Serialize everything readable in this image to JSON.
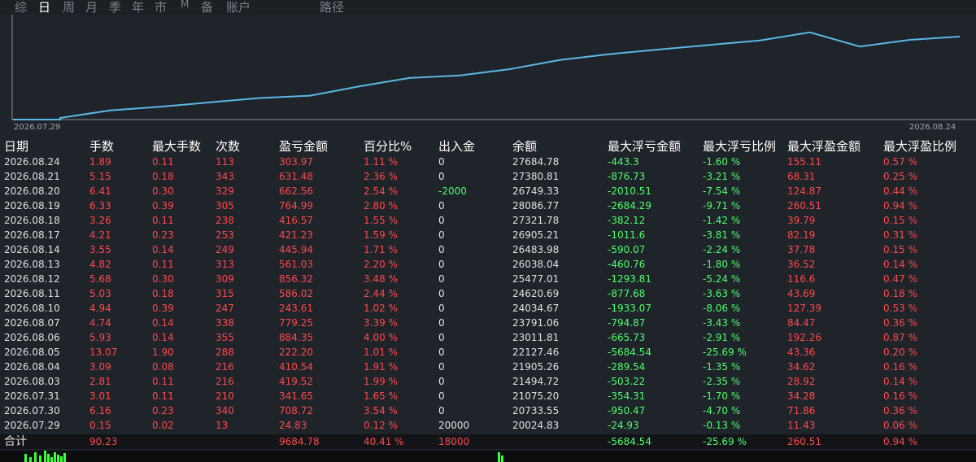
{
  "tabs": [
    "综",
    "日",
    "周",
    "月",
    "季",
    "年",
    "市",
    "M",
    "备",
    "账户",
    "路径"
  ],
  "active_tab": "日",
  "chart": {
    "start_date": "2026.07.29",
    "end_date": "2026.08.24",
    "line_color": "#5ab8e6",
    "balances": [
      20024.83,
      20733.55,
      21075.2,
      21494.72,
      21905.26,
      22127.46,
      23011.81,
      23791.06,
      24034.67,
      24620.69,
      25477.01,
      26038.04,
      26483.98,
      26905.21,
      27321.78,
      28086.77,
      26749.33,
      27380.81,
      27684.78
    ]
  },
  "table": {
    "headers": [
      "日期",
      "手数",
      "最大手数",
      "次数",
      "盈亏金额",
      "百分比%",
      "出入金",
      "余额",
      "最大浮亏金额",
      "最大浮亏比例",
      "最大浮盈金额",
      "最大浮盈比例"
    ],
    "rows": [
      [
        "2026.08.24",
        "1.89",
        "0.11",
        "113",
        "303.97",
        "1.11 %",
        "0",
        "27684.78",
        "-443.3",
        "-1.60 %",
        "155.11",
        "0.57 %"
      ],
      [
        "2026.08.21",
        "5.15",
        "0.18",
        "343",
        "631.48",
        "2.36 %",
        "0",
        "27380.81",
        "-876.73",
        "-3.21 %",
        "68.31",
        "0.25 %"
      ],
      [
        "2026.08.20",
        "6.41",
        "0.30",
        "329",
        "662.56",
        "2.54 %",
        "-2000",
        "26749.33",
        "-2010.51",
        "-7.54 %",
        "124.87",
        "0.44 %"
      ],
      [
        "2026.08.19",
        "6.33",
        "0.39",
        "305",
        "764.99",
        "2.80 %",
        "0",
        "28086.77",
        "-2684.29",
        "-9.71 %",
        "260.51",
        "0.94 %"
      ],
      [
        "2026.08.18",
        "3.26",
        "0.11",
        "238",
        "416.57",
        "1.55 %",
        "0",
        "27321.78",
        "-382.12",
        "-1.42 %",
        "39.79",
        "0.15 %"
      ],
      [
        "2026.08.17",
        "4.21",
        "0.23",
        "253",
        "421.23",
        "1.59 %",
        "0",
        "26905.21",
        "-1011.6",
        "-3.81 %",
        "82.19",
        "0.31 %"
      ],
      [
        "2026.08.14",
        "3.55",
        "0.14",
        "249",
        "445.94",
        "1.71 %",
        "0",
        "26483.98",
        "-590.07",
        "-2.24 %",
        "37.78",
        "0.15 %"
      ],
      [
        "2026.08.13",
        "4.82",
        "0.11",
        "313",
        "561.03",
        "2.20 %",
        "0",
        "26038.04",
        "-460.76",
        "-1.80 %",
        "36.52",
        "0.14 %"
      ],
      [
        "2026.08.12",
        "5.68",
        "0.30",
        "309",
        "856.32",
        "3.48 %",
        "0",
        "25477.01",
        "-1293.81",
        "-5.24 %",
        "116.6",
        "0.47 %"
      ],
      [
        "2026.08.11",
        "5.03",
        "0.18",
        "315",
        "586.02",
        "2.44 %",
        "0",
        "24620.69",
        "-877.68",
        "-3.63 %",
        "43.69",
        "0.18 %"
      ],
      [
        "2026.08.10",
        "4.94",
        "0.39",
        "247",
        "243.61",
        "1.02 %",
        "0",
        "24034.67",
        "-1933.07",
        "-8.06 %",
        "127.39",
        "0.53 %"
      ],
      [
        "2026.08.07",
        "4.74",
        "0.14",
        "338",
        "779.25",
        "3.39 %",
        "0",
        "23791.06",
        "-794.87",
        "-3.43 %",
        "84.47",
        "0.36 %"
      ],
      [
        "2026.08.06",
        "5.93",
        "0.14",
        "355",
        "884.35",
        "4.00 %",
        "0",
        "23011.81",
        "-665.73",
        "-2.91 %",
        "192.26",
        "0.87 %"
      ],
      [
        "2026.08.05",
        "13.07",
        "1.90",
        "288",
        "222.20",
        "1.01 %",
        "0",
        "22127.46",
        "-5684.54",
        "-25.69 %",
        "43.36",
        "0.20 %"
      ],
      [
        "2026.08.04",
        "3.09",
        "0.08",
        "216",
        "410.54",
        "1.91 %",
        "0",
        "21905.26",
        "-289.54",
        "-1.35 %",
        "34.62",
        "0.16 %"
      ],
      [
        "2026.08.03",
        "2.81",
        "0.11",
        "216",
        "419.52",
        "1.99 %",
        "0",
        "21494.72",
        "-503.22",
        "-2.35 %",
        "28.92",
        "0.14 %"
      ],
      [
        "2026.07.31",
        "3.01",
        "0.11",
        "210",
        "341.65",
        "1.65 %",
        "0",
        "21075.20",
        "-354.31",
        "-1.70 %",
        "34.28",
        "0.16 %"
      ],
      [
        "2026.07.30",
        "6.16",
        "0.23",
        "340",
        "708.72",
        "3.54 %",
        "0",
        "20733.55",
        "-950.47",
        "-4.70 %",
        "71.86",
        "0.36 %"
      ],
      [
        "2026.07.29",
        "0.15",
        "0.02",
        "13",
        "24.83",
        "0.12 %",
        "20000",
        "20024.83",
        "-24.93",
        "-0.13 %",
        "11.43",
        "0.06 %"
      ]
    ],
    "total": [
      "合计",
      "90.23",
      "",
      "",
      "9684.78",
      "40.41 %",
      "18000",
      "",
      "-5684.54",
      "-25.69 %",
      "260.51",
      "0.94 %"
    ]
  },
  "colors": {
    "positive": "#ff4a4a",
    "negative": "#4cff6a",
    "neutral": "#e0e0e0"
  }
}
